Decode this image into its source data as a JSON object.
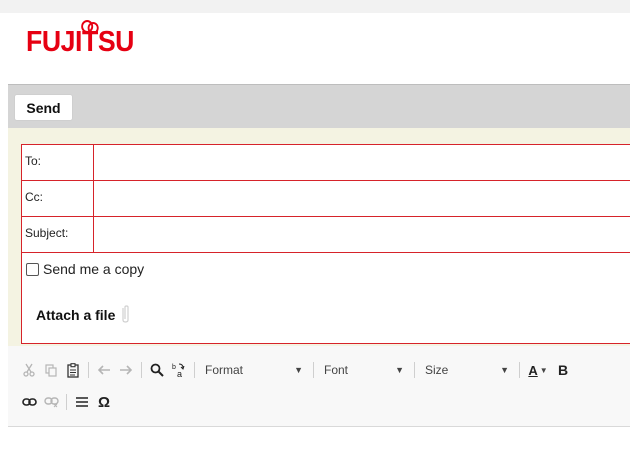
{
  "brand": {
    "logo_text": "FUJITSU",
    "color": "#e60012"
  },
  "toolbar": {
    "send_label": "Send"
  },
  "form": {
    "to_label": "To:",
    "cc_label": "Cc:",
    "subject_label": "Subject:",
    "to_value": "",
    "cc_value": "",
    "subject_value": "",
    "send_copy_label": "Send me a copy",
    "attach_label": "Attach a file"
  },
  "editor_toolbar": {
    "format_label": "Format",
    "font_label": "Font",
    "size_label": "Size",
    "bold_label": "B",
    "special_char_label": "Ω",
    "font_color_label": "A"
  },
  "colors": {
    "form_border": "#d6232a",
    "form_background": "#f4f3e2",
    "toolbar_background": "#d5d5d5"
  }
}
